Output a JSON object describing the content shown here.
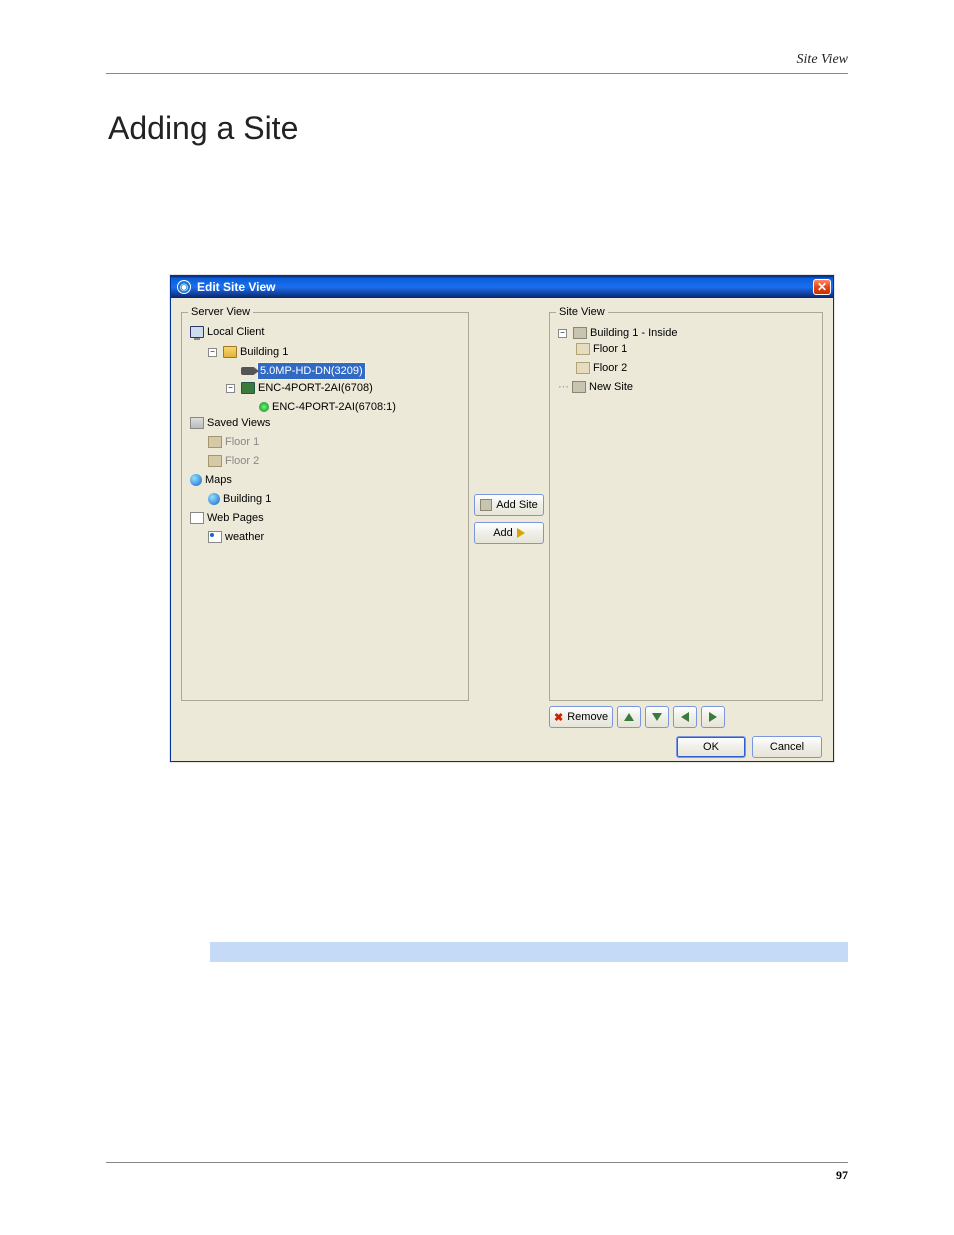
{
  "header": {
    "breadcrumb": "Site View"
  },
  "page": {
    "heading": "Adding a Site",
    "number": "97"
  },
  "dialog": {
    "title": "Edit Site View",
    "close": "✕",
    "server_view": {
      "legend": "Server View",
      "root": "Local Client",
      "building": "Building 1",
      "camera": "5.0MP-HD-DN(3209)",
      "encoder": "ENC-4PORT-2AI(6708)",
      "channel": "ENC-4PORT-2AI(6708:1)",
      "saved_views": "Saved Views",
      "floor1": "Floor 1",
      "floor2": "Floor 2",
      "maps": "Maps",
      "map_building": "Building 1",
      "web_pages": "Web Pages",
      "weather": "weather"
    },
    "mid": {
      "add_site": "Add Site",
      "add": "Add"
    },
    "site_view": {
      "legend": "Site View",
      "root": "Building 1 - Inside",
      "floor1": "Floor 1",
      "floor2": "Floor 2",
      "new_site": "New Site"
    },
    "actions": {
      "remove": "Remove",
      "ok": "OK",
      "cancel": "Cancel"
    },
    "expand_minus": "−"
  }
}
